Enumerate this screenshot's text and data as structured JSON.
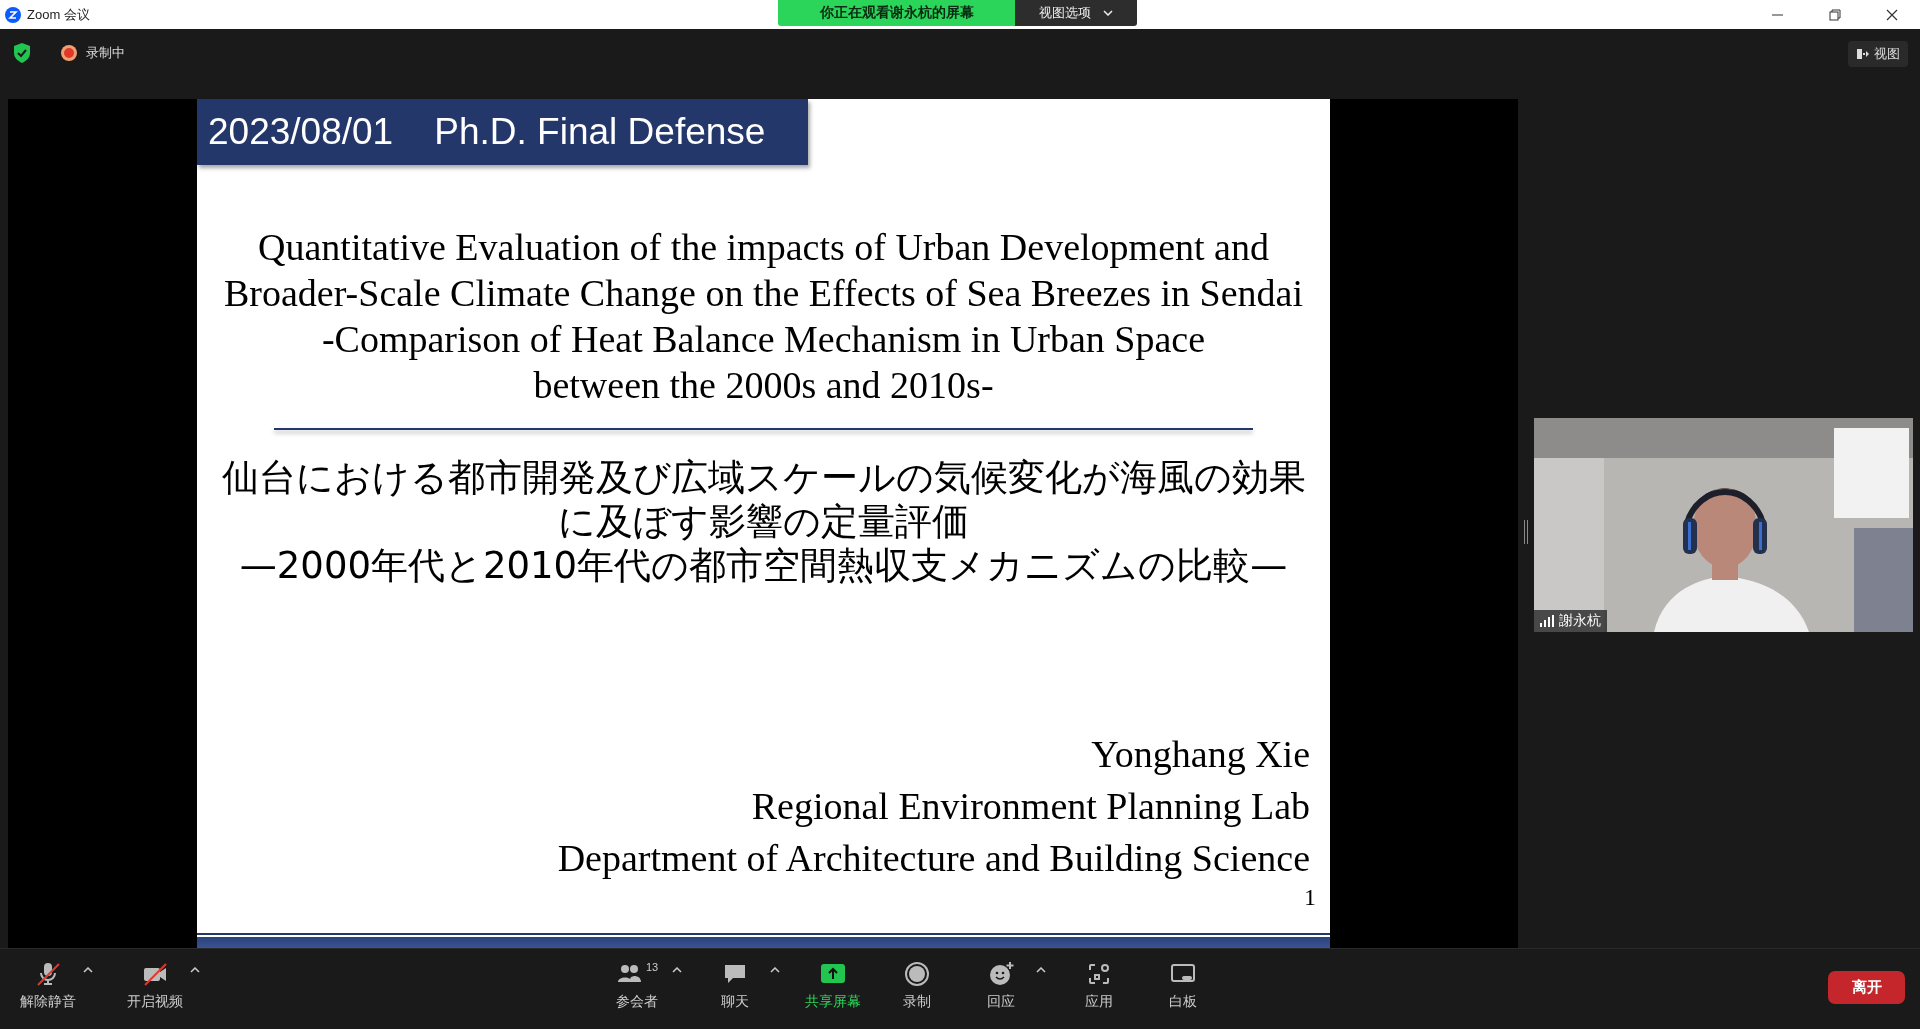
{
  "window": {
    "title": "Zoom 会议"
  },
  "share_banner": {
    "text": "你正在观看谢永杭的屏幕",
    "view_options": "视图选项"
  },
  "top_bar": {
    "recording_label": "录制中",
    "view_button": "视图"
  },
  "slide": {
    "header": "2023/08/01    Ph.D. Final Defense",
    "title_lines": [
      "Quantitative Evaluation of the impacts of Urban Development and",
      "Broader-Scale Climate Change on the Effects of Sea Breezes in Sendai",
      "-Comparison of Heat Balance Mechanism in Urban Space",
      "between the 2000s and 2010s-"
    ],
    "japanese_lines": [
      "仙台における都市開発及び広域スケールの気候変化が海風の効果",
      "に及ぼす影響の定量評価",
      "—2000年代と2010年代の都市空間熱収支メカニズムの比較—"
    ],
    "author_lines": [
      "Yonghang Xie",
      "Regional Environment Planning Lab",
      "Department of Architecture and Building Science"
    ],
    "page_number": "1"
  },
  "video": {
    "kind": "picture",
    "name": "謝永杭"
  },
  "toolbar": [
    {
      "kind": "mic",
      "label": "解除静音",
      "off": true,
      "has_menu": true
    },
    {
      "kind": "camera",
      "label": "开启视频",
      "off": true,
      "has_menu": true
    },
    {
      "kind": "participants",
      "label": "参会者",
      "count": "13",
      "off": false,
      "has_menu": true
    },
    {
      "kind": "chat",
      "label": "聊天",
      "off": false,
      "has_menu": true
    },
    {
      "kind": "share",
      "label": "共享屏幕",
      "off": false,
      "has_menu": false
    },
    {
      "kind": "record",
      "label": "录制",
      "off": false,
      "has_menu": false
    },
    {
      "kind": "reactions",
      "label": "回应",
      "off": false,
      "has_menu": true
    },
    {
      "kind": "apps",
      "label": "应用",
      "off": false,
      "has_menu": false
    },
    {
      "kind": "whiteboard",
      "label": "白板",
      "off": false,
      "has_menu": false
    }
  ],
  "leave_button": "离开"
}
